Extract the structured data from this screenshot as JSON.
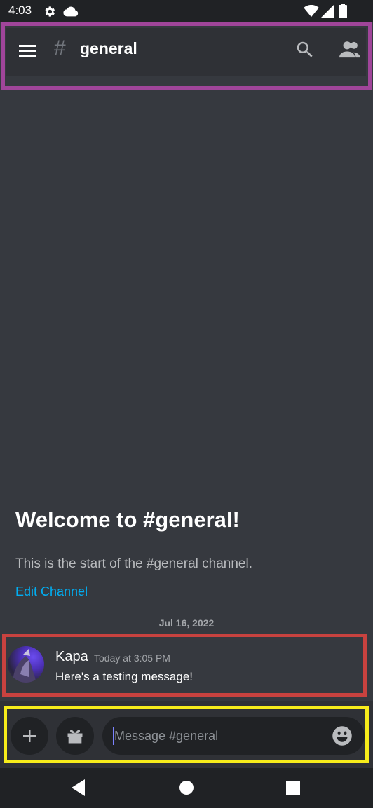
{
  "status_bar": {
    "time": "4:03",
    "icons": [
      "settings-gear-icon",
      "cloud-icon",
      "wifi-icon",
      "signal-icon",
      "battery-icon"
    ]
  },
  "header": {
    "hash_symbol": "#",
    "channel_name": "general",
    "icons": [
      "hamburger-menu-icon",
      "search-icon",
      "members-icon"
    ]
  },
  "welcome": {
    "title": "Welcome to #general!",
    "subtitle": "This is the start of the #general channel.",
    "edit_link": "Edit Channel"
  },
  "divider": {
    "date": "Jul 16, 2022"
  },
  "message": {
    "author": "Kapa",
    "timestamp": "Today at 3:05 PM",
    "text": "Here's a testing message!"
  },
  "composer": {
    "placeholder": "Message #general",
    "icons": [
      "plus-icon",
      "gift-icon",
      "emoji-icon"
    ]
  },
  "nav": {
    "icons": [
      "back-icon",
      "home-icon",
      "recents-icon"
    ]
  },
  "colors": {
    "background": "#36393f",
    "header_bg": "#2f3136",
    "status_bar_bg": "#202225",
    "link": "#00aff4",
    "highlight_header": "#a0459a",
    "highlight_message": "#c8423f",
    "highlight_composer": "#f7ec1b"
  }
}
